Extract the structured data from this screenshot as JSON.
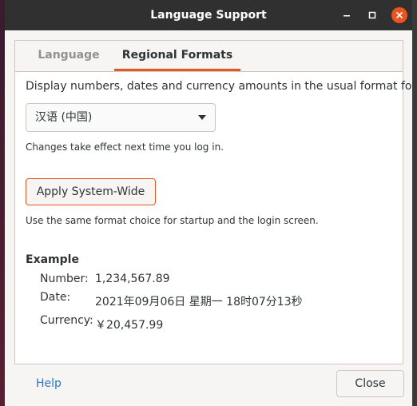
{
  "window": {
    "title": "Language Support"
  },
  "tabs": [
    {
      "label": "Language",
      "active": false
    },
    {
      "label": "Regional Formats",
      "active": true
    }
  ],
  "regional": {
    "description": "Display numbers, dates and currency amounts in the usual format for:",
    "format_select": {
      "selected": "汉语 (中国)"
    },
    "change_note": "Changes take effect next time you log in.",
    "apply_button": "Apply System-Wide",
    "apply_note": "Use the same format choice for startup and the login screen.",
    "example": {
      "heading": "Example",
      "number_label": "Number:",
      "number_value": "1,234,567.89",
      "date_label": "Date:",
      "date_value": "2021年09月06日 星期一 18时07分13秒",
      "currency_label": "Currency:",
      "currency_value": "￥20,457.99"
    }
  },
  "footer": {
    "help_label": "Help",
    "close_label": "Close"
  },
  "colors": {
    "accent": "#e95420",
    "titlebar": "#303030",
    "link": "#2a76c6"
  }
}
